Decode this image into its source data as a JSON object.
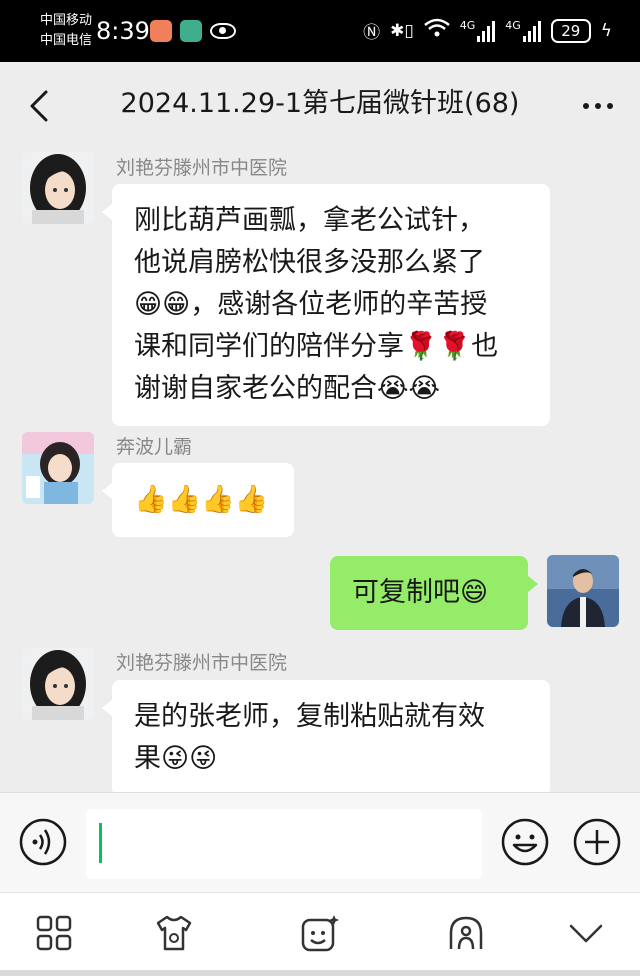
{
  "status_bar": {
    "carrier_1": "中国移动",
    "carrier_2": "中国电信",
    "time": "8:39",
    "network_1": "4G",
    "network_2": "4G",
    "battery": "29"
  },
  "header": {
    "back_icon": "back-chevron-icon",
    "title": "2024.11.29-1第七届微针班(68)",
    "more_icon": "more-dots-icon"
  },
  "messages": [
    {
      "sender": "刘艳芬滕州市中医院",
      "lines": [
        "刚比葫芦画瓢，拿老公试针，",
        "他说肩膀松快很多没那么紧了",
        "😁😁，感谢各位老师的辛苦授",
        "课和同学们的陪伴分享🌹🌹也",
        "谢谢自家老公的配合😭😭"
      ]
    },
    {
      "sender": "奔波儿霸",
      "lines": [
        "👍👍👍👍"
      ]
    },
    {
      "sender": "",
      "lines": [
        "可复制吧😄"
      ]
    },
    {
      "sender": "刘艳芬滕州市中医院",
      "lines": [
        "是的张老师，复制粘贴就有效",
        "果😜😜"
      ]
    }
  ],
  "input_bar": {
    "voice_icon": "voice-icon",
    "text_value": "",
    "emoji_icon": "emoji-icon",
    "plus_icon": "plus-icon"
  },
  "toolbar": {
    "icons": [
      "grid-apps-icon",
      "tshirt-du-icon",
      "sticker-face-icon",
      "rainbow-figure-icon",
      "chevron-down-icon"
    ]
  },
  "colors": {
    "accent": "#07c160",
    "outgoing_bubble": "#95ec69",
    "incoming_bubble": "#ffffff",
    "background": "#ededed"
  }
}
